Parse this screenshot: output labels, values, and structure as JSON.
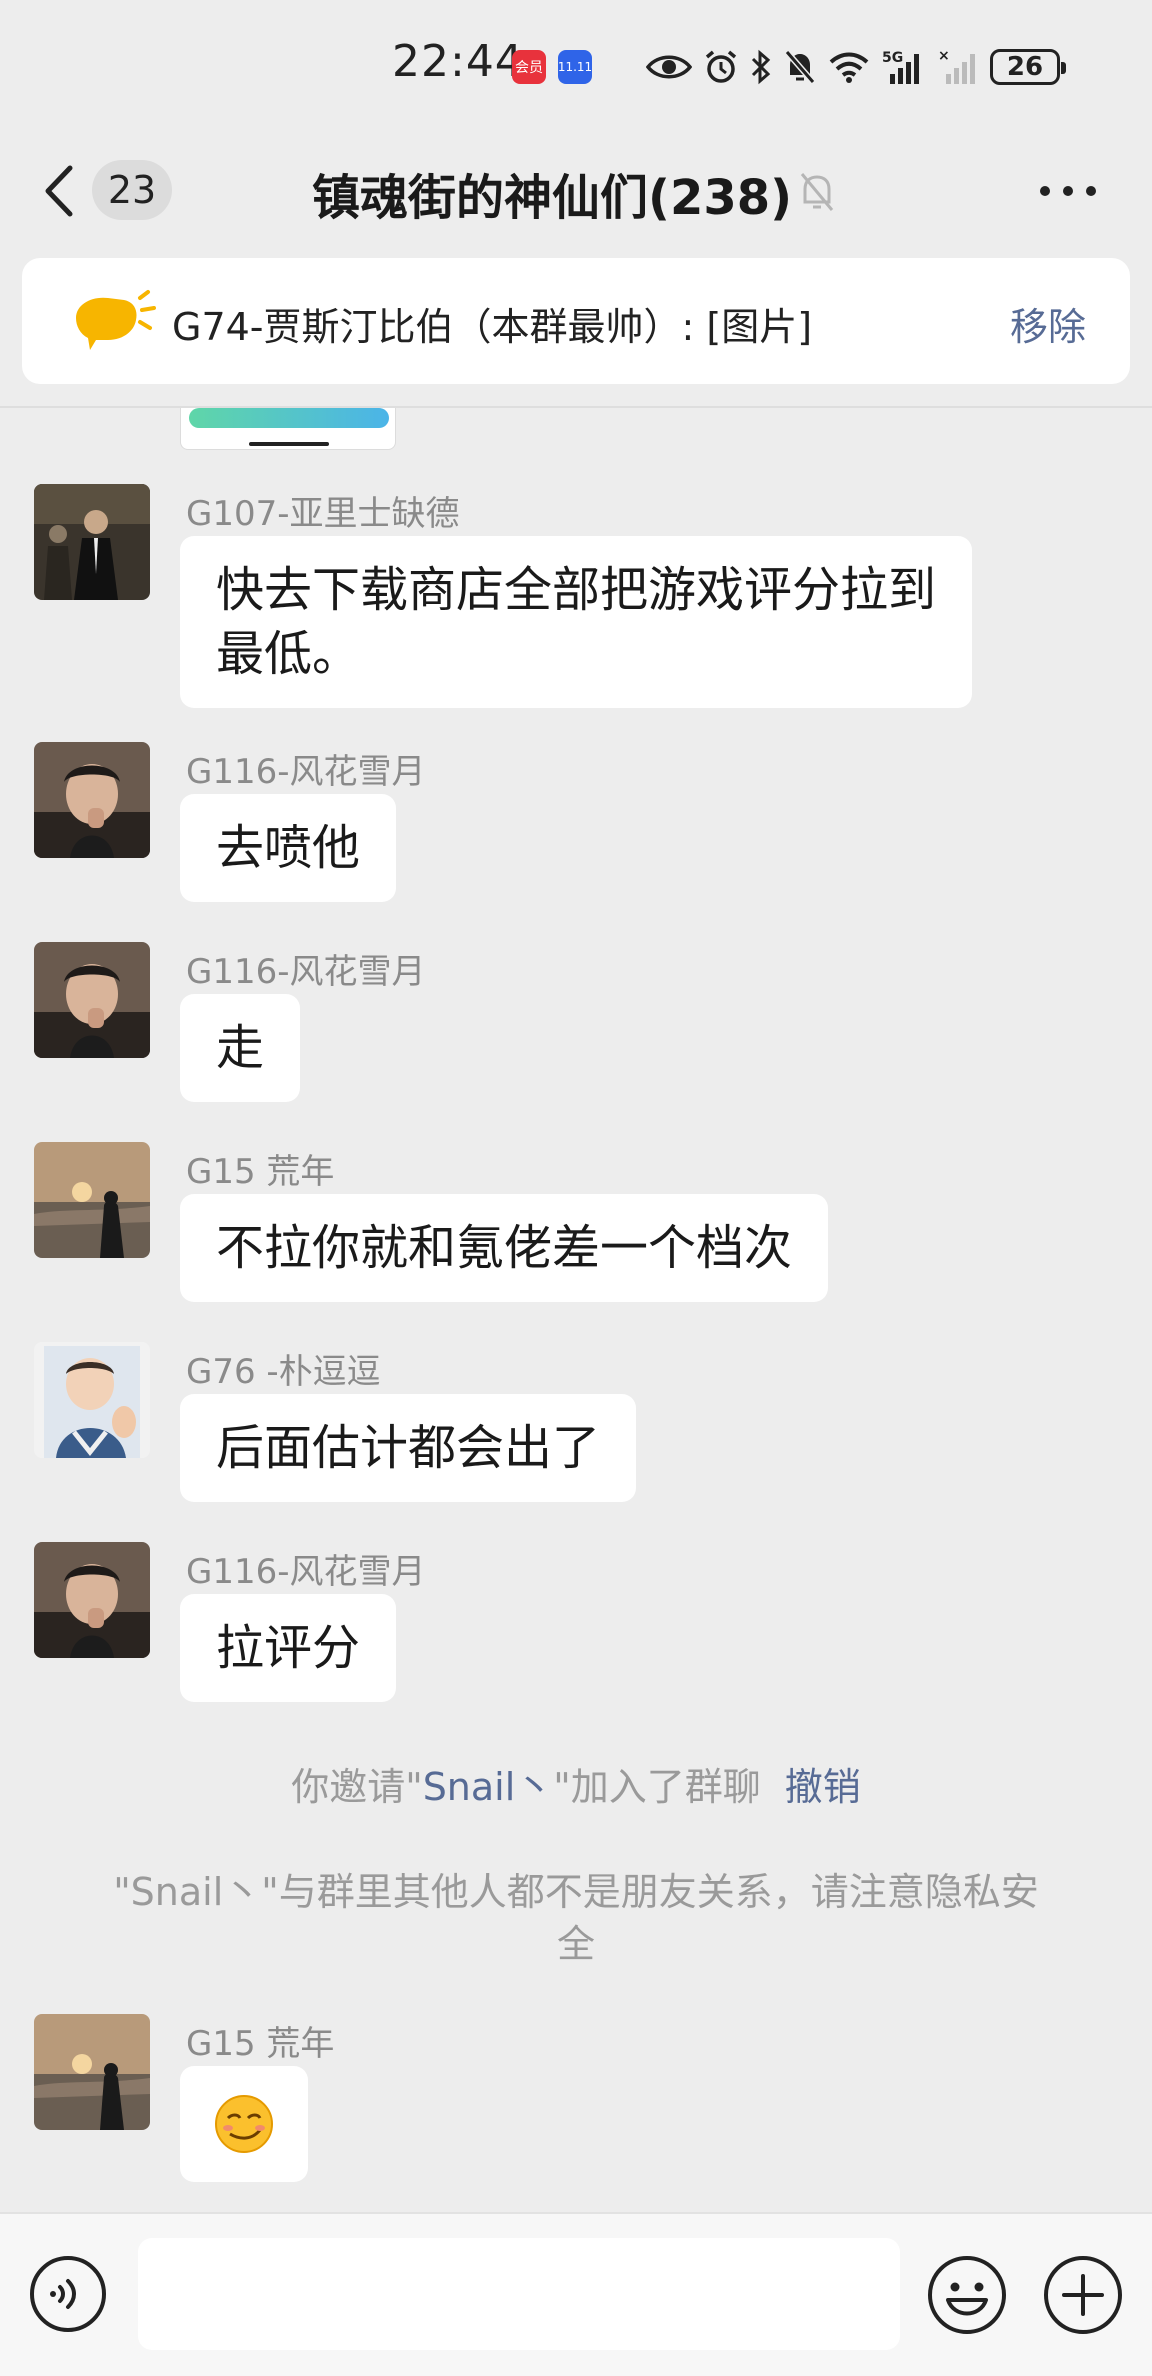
{
  "status_bar": {
    "time": "22:44",
    "app1_label": "会员",
    "app2_label": "11.11",
    "network": "5G",
    "battery": "26"
  },
  "header": {
    "unread_count": "23",
    "title": "镇魂街的神仙们(238)"
  },
  "pinned": {
    "text": "G74-贾斯汀比伯（本群最帅）: [图片]",
    "remove_label": "移除"
  },
  "messages": [
    {
      "sender": "G107-亚里士缺德",
      "lines": [
        "快去下载商店全部把游戏评分拉到",
        "最低。"
      ]
    },
    {
      "sender": "G116-风花雪月",
      "text": "去喷他"
    },
    {
      "sender": "G116-风花雪月",
      "text": "走"
    },
    {
      "sender": "G15 荒年",
      "text": "不拉你就和氪佬差一个档次"
    },
    {
      "sender": "G76 -朴逗逗",
      "text": "后面估计都会出了"
    },
    {
      "sender": "G116-风花雪月",
      "text": "拉评分"
    },
    {
      "sender": "G15 荒年",
      "text": "😏"
    }
  ],
  "system": {
    "invite_prefix": "你邀请\"",
    "invite_name": "Snail丶",
    "invite_suffix": "\"加入了群聊",
    "invite_action": "撤销",
    "privacy_line1": "\"Snail丶\"与群里其他人都不是朋友关系，请注意隐私安",
    "privacy_line2": "全"
  },
  "colors": {
    "background": "#ededed",
    "bubble": "#ffffff",
    "link": "#576b95",
    "meta_text": "#8a8a8a"
  },
  "icons": [
    "back-icon",
    "mute-bell-icon",
    "more-icon",
    "speaker-announcement-icon",
    "voice-icon",
    "emoji-icon",
    "plus-icon"
  ]
}
